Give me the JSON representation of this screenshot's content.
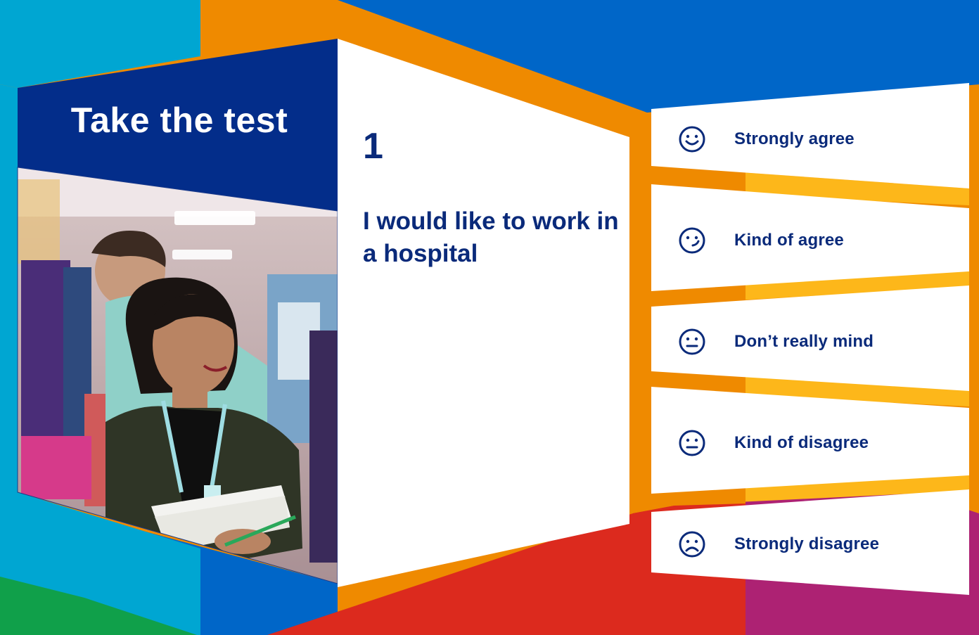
{
  "slide": {
    "title": "Take the test",
    "question_number": "1",
    "question_text": "I would like to work in a hospital"
  },
  "answers": [
    {
      "label": "Strongly agree",
      "icon": "smile-icon"
    },
    {
      "label": "Kind of agree",
      "icon": "wink-icon"
    },
    {
      "label": "Don’t really mind",
      "icon": "neutral-face-icon"
    },
    {
      "label": "Kind of disagree",
      "icon": "neutral-face-icon"
    },
    {
      "label": "Strongly disagree",
      "icon": "frown-icon"
    }
  ],
  "colors": {
    "navy": "#0a2a7a",
    "blue": "#0066c8",
    "cyan": "#00a6d2",
    "orange": "#ef8a00",
    "yellow": "#fdb71a",
    "red": "#dc2a1e",
    "magenta": "#ad2273",
    "green": "#10a04a"
  }
}
